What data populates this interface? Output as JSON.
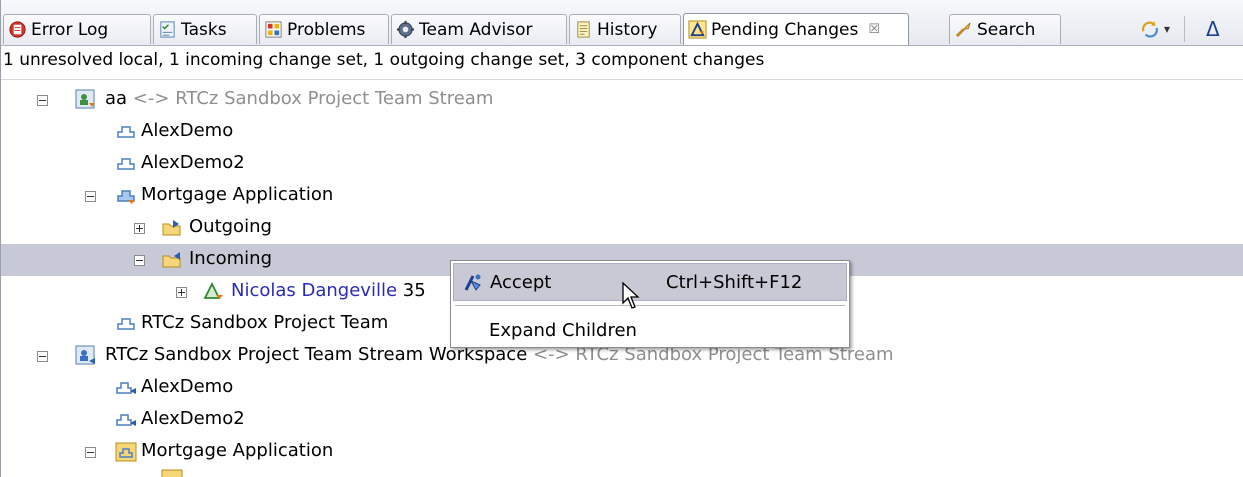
{
  "tabs": [
    {
      "label": "Error Log",
      "icon": "error-log-icon"
    },
    {
      "label": "Tasks",
      "icon": "tasks-icon"
    },
    {
      "label": "Problems",
      "icon": "problems-icon"
    },
    {
      "label": "Team Advisor",
      "icon": "team-advisor-icon"
    },
    {
      "label": "History",
      "icon": "history-icon"
    },
    {
      "label": "Pending Changes",
      "icon": "pending-changes-icon",
      "active": true,
      "close": "☒"
    },
    {
      "label": "Search",
      "icon": "search-icon"
    }
  ],
  "toolbar": {
    "sync_icon": "sync-icon",
    "dropdown_glyph": "▾",
    "delta_glyph": "Δ"
  },
  "status": "1 unresolved local, 1 incoming change set, 1 outgoing change set, 3 component changes",
  "tree": {
    "workspace1": {
      "name": "aa",
      "separator": "<->",
      "target": "RTCz Sandbox Project Team Stream"
    },
    "alexdemo": "AlexDemo",
    "alexdemo2": "AlexDemo2",
    "mortgage": "Mortgage Application",
    "outgoing": "Outgoing",
    "incoming": "Incoming",
    "changeset_author": "Nicolas Dangeville",
    "changeset_suffix": "35",
    "rtcz_team": "RTCz Sandbox Project Team",
    "workspace2": {
      "name": "RTCz Sandbox Project Team Stream Workspace",
      "separator": "<->",
      "target": "RTCz Sandbox Project Team Stream"
    },
    "w2_alexdemo": "AlexDemo",
    "w2_alexdemo2": "AlexDemo2",
    "w2_mortgage": "Mortgage Application"
  },
  "context_menu": {
    "accept": {
      "label": "Accept",
      "shortcut": "Ctrl+Shift+F12"
    },
    "expand_children": {
      "label": "Expand Children"
    }
  },
  "colors": {
    "selection": "#c8c9d6",
    "incoming_blue": "#2a2ab8",
    "muted_gray": "#8f8f8f"
  }
}
